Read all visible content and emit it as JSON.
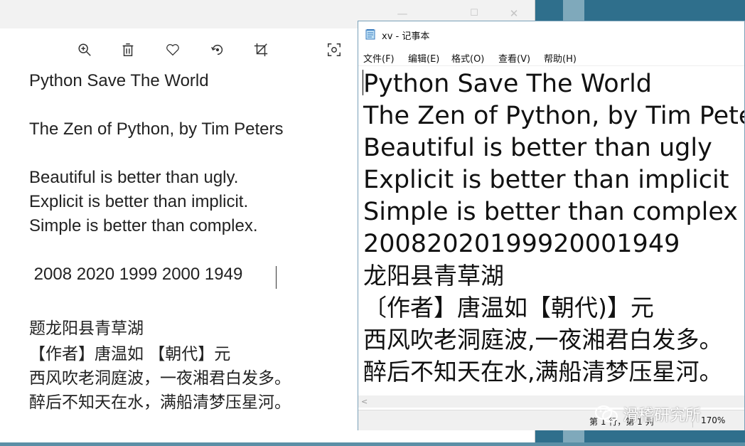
{
  "photos": {
    "window_controls": {
      "minimize": "—",
      "maximize": "☐",
      "close": "✕"
    },
    "toolbar": [
      {
        "name": "zoom-icon"
      },
      {
        "name": "delete-icon"
      },
      {
        "name": "favorite-icon"
      },
      {
        "name": "rotate-icon"
      },
      {
        "name": "crop-icon"
      },
      {
        "name": "scan-text-icon"
      }
    ],
    "image_text": [
      "Python Save The World",
      "The Zen of Python, by Tim Peters",
      "Beautiful is better than ugly.",
      "Explicit is better than implicit.",
      "Simple is better than complex.",
      " 2008 2020 1999 2000 1949",
      "题龙阳县青草湖",
      "【作者】唐温如 【朝代】元",
      "西风吹老洞庭波，一夜湘君白发多。",
      "醉后不知天在水，满船清梦压星河。"
    ]
  },
  "notepad": {
    "title": "xv - 记事本",
    "menu": [
      "文件(F)",
      "编辑(E)",
      "格式(O)",
      "查看(V)",
      "帮助(H)"
    ],
    "lines": [
      "Python Save The World",
      "The Zen of Python, by Tim Peters",
      "Beautiful is better than ugly",
      "Explicit is better than implicit",
      "Simple is better than complex",
      "20082020199920001949",
      "龙阳县青草湖",
      "〔作者】唐温如【朝代)】元",
      "西风吹老洞庭波,一夜湘君白发多。",
      "醉后不知天在水,满船清梦压星河。"
    ],
    "scroll_left": "<",
    "status": {
      "position": "第 1 行，第 1 列",
      "zoom": "170%"
    }
  },
  "watermark": {
    "text": "滑稽研究所"
  },
  "colors": {
    "desktop": "#2f6f8c",
    "photos_bg": "#ffffff",
    "notepad_border": "#7aa0b8"
  }
}
